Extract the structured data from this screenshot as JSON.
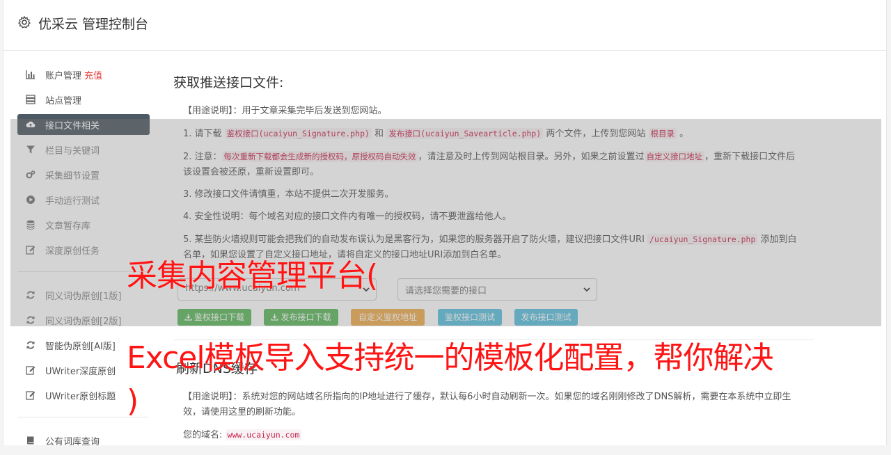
{
  "header": {
    "title": "优采云 管理控制台",
    "icon": "gear-icon"
  },
  "sidebar": {
    "items": [
      {
        "label": "账户管理",
        "extra": "充值",
        "icon": "bar-chart-icon"
      },
      {
        "label": "站点管理",
        "icon": "server-icon"
      },
      {
        "label": "接口文件相关",
        "icon": "cloud-upload-icon",
        "active": true
      },
      {
        "label": "栏目与关键词",
        "icon": "filter-icon"
      },
      {
        "label": "采集细节设置",
        "icon": "cogs-icon"
      },
      {
        "label": "手动运行测试",
        "icon": "play-circle-icon"
      },
      {
        "label": "文章暂存库",
        "icon": "database-icon"
      },
      {
        "label": "深度原创任务",
        "icon": "edit-icon"
      }
    ],
    "items2": [
      {
        "label": "同义词伪原创[1版]",
        "icon": "refresh-icon"
      },
      {
        "label": "同义词伪原创[2版]",
        "icon": "refresh-icon"
      },
      {
        "label": "智能伪原创[AI版]",
        "icon": "refresh-icon"
      },
      {
        "label": "UWriter深度原创",
        "icon": "edit-icon"
      },
      {
        "label": "UWriter原创标题",
        "icon": "edit-icon"
      }
    ],
    "items3": [
      {
        "label": "公有词库查询",
        "icon": "book-icon"
      }
    ]
  },
  "main": {
    "section1_title": "获取推送接口文件:",
    "usage": "【用途说明】：用于文章采集完毕后发送到您网站。",
    "p1": {
      "a": "1. 请下载 ",
      "code1": "鉴权接口(ucaiyun_Signature.php)",
      "b": " 和 ",
      "code2": "发布接口(ucaiyun_Savearticle.php)",
      "c": " 两个文件，上传到您网站 ",
      "code3": "根目录",
      "d": " 。"
    },
    "p2": {
      "a": "2. 注意：",
      "code1": "每次重新下载都会生成新的授权码，原授权码自动失效",
      "b": "，请注意及时上传到网站根目录。另外，如果之前设置过",
      "code2": "自定义接口地址",
      "c": "，重新下载接口文件后该设置会被还原，重新设置即可。"
    },
    "p3": "3. 修改接口文件请慎重，本站不提供二次开发服务。",
    "p4": "4. 安全性说明：每个域名对应的接口文件内有唯一的授权码，请不要泄露给他人。",
    "p5": {
      "a": "5. 某些防火墙规则可能会把我们的自动发布误认为是黑客行为，如果您的服务器开启了防火墙，建议把接口文件URI ",
      "code1": "/ucaiyun_Signature.php",
      "b": " 添加到白名单，如果您设置了自定义接口地址，请将自定义的接口地址URI添加到白名单。"
    },
    "select_site": "https://www.ucaiyun.com",
    "select_api": "请选择您需要的接口",
    "buttons": {
      "sig_download": "鉴权接口下载",
      "pub_download": "发布接口下载",
      "custom_sig": "自定义鉴权地址",
      "sig_test": "鉴权接口测试",
      "pub_test": "发布接口测试"
    },
    "section2_title": "刷新DNS缓存",
    "dns_usage": "【用途说明】：系统对您的网站域名所指向的IP地址进行了缓存，默认每6小时自动刷新一次。如果您的域名刚刚修改了DNS解析，需要在本系统中立即生效，请使用这里的刷新功能。",
    "domain_label": "您的域名:",
    "domain_value": "www.ucaiyun.com"
  },
  "watermark": {
    "line1": "采集内容管理平台(",
    "line2": "Excel模板导入支持统一的模板化配置，帮你解决",
    "line3": ")"
  },
  "colors": {
    "active_bg": "#4e5a63",
    "green": "#5cb85c",
    "orange": "#f0ad4e",
    "blue": "#5bc0de",
    "code": "#c7254e",
    "watermark": "#ff1414"
  }
}
